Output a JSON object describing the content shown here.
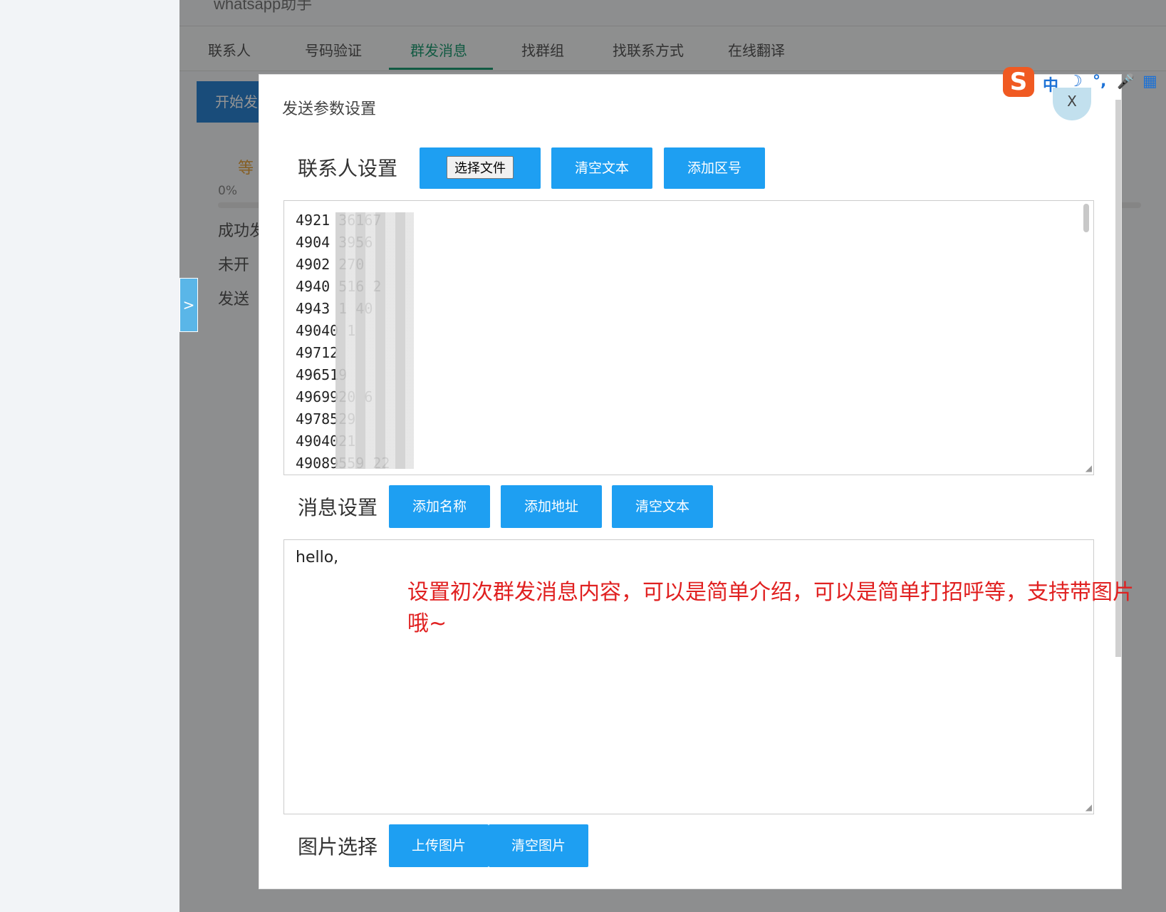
{
  "app": {
    "title": "whatsapp助手",
    "tabs": [
      "联系人",
      "号码验证",
      "群发消息",
      "找群组",
      "找联系方式",
      "在线翻译"
    ],
    "active_tab_index": 2,
    "start_button": "开始发",
    "wait_label": "等",
    "progress_percent": "0%",
    "stats": [
      "成功发",
      "未开",
      "发送"
    ],
    "side_toggle": ">"
  },
  "modal": {
    "title": "发送参数设置",
    "close_label": "X",
    "contacts": {
      "label": "联系人设置",
      "choose_file": "选择文件",
      "clear_text": "清空文本",
      "add_area_code": "添加区号",
      "numbers": [
        "4921 36167",
        "4904 3956",
        "4902 270",
        "4940 516 2",
        "4943 1 40",
        "49040 1",
        "49712",
        "496519",
        "4969920 6",
        "4978529",
        "4904021",
        "49089559 22"
      ]
    },
    "message": {
      "label": "消息设置",
      "add_name": "添加名称",
      "add_address": "添加地址",
      "clear_text": "清空文本",
      "content": "hello,",
      "annotation": "设置初次群发消息内容，可以是简单介绍，可以是简单打招呼等，支持带图片哦~"
    },
    "image": {
      "label": "图片选择",
      "upload": "上传图片",
      "clear": "清空图片"
    }
  },
  "ime": {
    "logo": "S",
    "items": [
      "中",
      "☽",
      "°,",
      "🎤",
      "▦"
    ]
  },
  "colors": {
    "primary_blue": "#1e9ff2",
    "active_tab": "#1e9c72",
    "annotation_red": "#e02020",
    "ime_orange": "#f05a22"
  }
}
